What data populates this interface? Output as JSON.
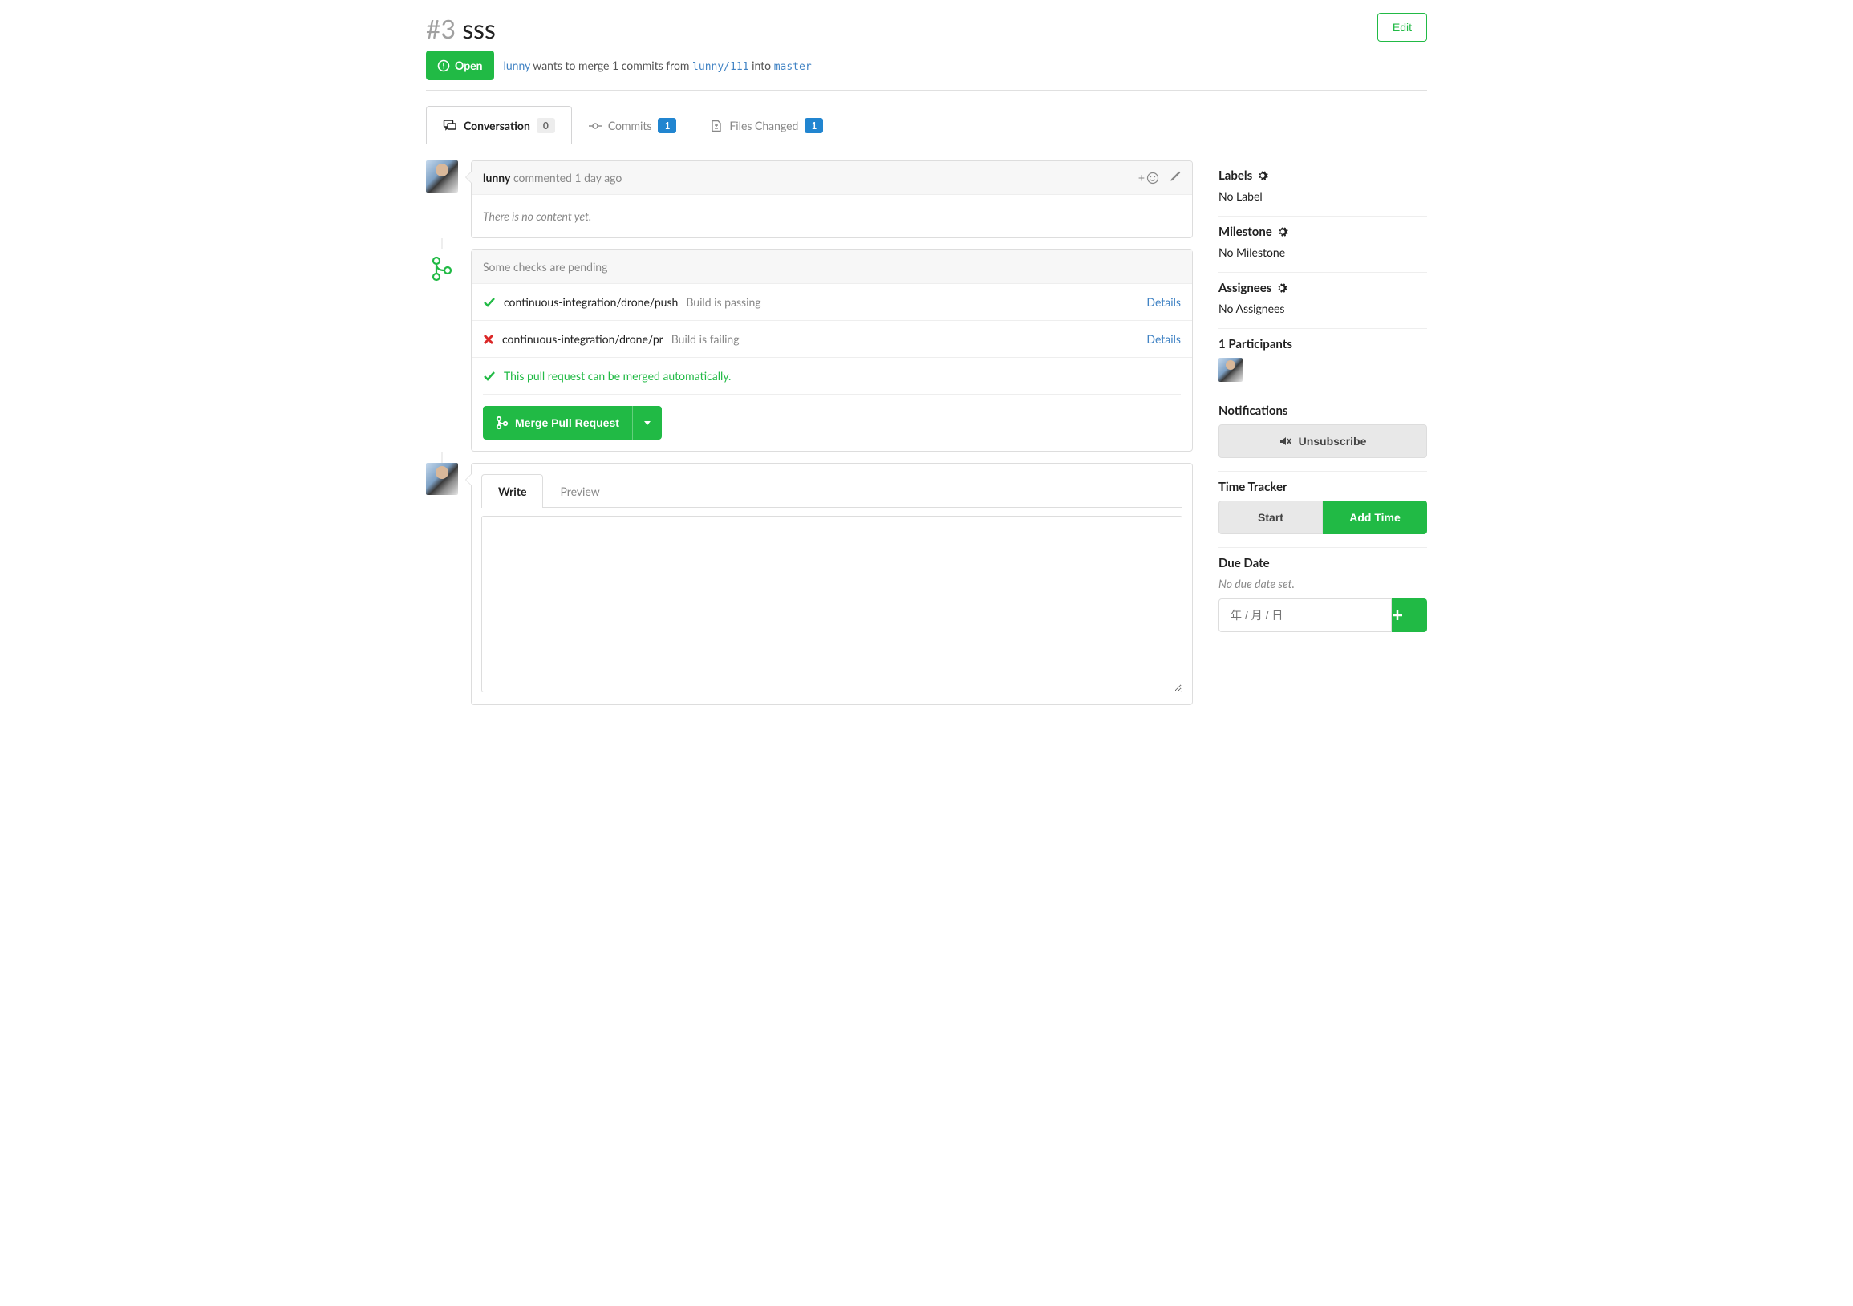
{
  "issue": {
    "number": "#3",
    "title": "sss"
  },
  "edit_label": "Edit",
  "status": {
    "label": "Open"
  },
  "merge_info": {
    "actor": "lunny",
    "text1": "wants to merge 1 commits from",
    "source_ref": "lunny/111",
    "text2": "into",
    "target_ref": "master"
  },
  "tabs": {
    "conversation": {
      "label": "Conversation",
      "count": "0"
    },
    "commits": {
      "label": "Commits",
      "count": "1"
    },
    "files": {
      "label": "Files Changed",
      "count": "1"
    }
  },
  "comment": {
    "author": "lunny",
    "verb": "commented",
    "time": "1 day ago",
    "body": "There is no content yet.",
    "add_reaction_prefix": "+"
  },
  "checks": {
    "header": "Some checks are pending",
    "items": [
      {
        "status": "success",
        "name": "continuous-integration/drone/push",
        "desc": "Build is passing",
        "link": "Details"
      },
      {
        "status": "fail",
        "name": "continuous-integration/drone/pr",
        "desc": "Build is failing",
        "link": "Details"
      }
    ],
    "mergeable_text": "This pull request can be merged automatically.",
    "merge_button": "Merge Pull Request"
  },
  "editor": {
    "write": "Write",
    "preview": "Preview"
  },
  "sidebar": {
    "labels": {
      "title": "Labels",
      "value": "No Label"
    },
    "milestone": {
      "title": "Milestone",
      "value": "No Milestone"
    },
    "assignees": {
      "title": "Assignees",
      "value": "No Assignees"
    },
    "participants": {
      "title": "1 Participants"
    },
    "notifications": {
      "title": "Notifications",
      "button": "Unsubscribe"
    },
    "tracker": {
      "title": "Time Tracker",
      "start": "Start",
      "add": "Add Time"
    },
    "due": {
      "title": "Due Date",
      "empty": "No due date set.",
      "placeholder": "年 / 月 / 日"
    }
  }
}
